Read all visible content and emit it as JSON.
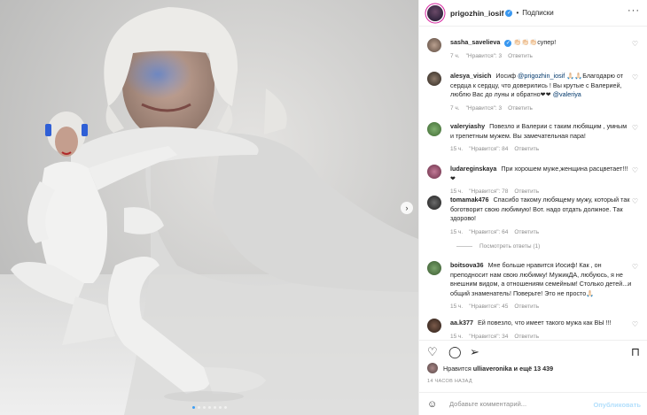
{
  "header": {
    "username": "prigozhin_iosif",
    "separator": "•",
    "follow_label": "Подписки",
    "more_icon": "more-horizontal-icon"
  },
  "comments": [
    {
      "user": "sasha_savelieva",
      "verified": true,
      "text": "👏🏻👏🏻👏🏻супер!",
      "time": "7 ч.",
      "likes": "\"Нравится\": 3",
      "reply": "Ответить"
    },
    {
      "user": "alesya_visich",
      "verified": false,
      "mention_pre": "Иосиф ",
      "mention1": "@prigozhin_iosif",
      "text_mid": " 🙏🏻🙏🏻Благодарю от сердца к сердцу, что доверились ! Вы крутые с Валерией, люблю Вас до луны и обратно❤❤ ",
      "mention2": "@valeriya",
      "time": "7 ч.",
      "likes": "\"Нравится\": 3",
      "reply": "Ответить"
    },
    {
      "user": "valeryiashy",
      "text": "Повезло и Валерии с таким любящим , умным и трепетным мужем. Вы замечательная пара!",
      "time": "15 ч.",
      "likes": "\"Нравится\": 84",
      "reply": "Ответить"
    },
    {
      "user": "ludareginskaya",
      "text": "При хорошем муже,женщина расцветает!!!❤",
      "time": "15 ч.",
      "likes": "\"Нравится\": 78",
      "reply": "Ответить"
    },
    {
      "user": "tomamak476",
      "text": "Спасибо такому любящему мужу, который так боготворит свою любимую! Вот. надо отдать должное. Так здорово!",
      "time": "15 ч.",
      "likes": "\"Нравится\": 64",
      "reply": "Ответить"
    },
    {
      "user": "boitsova36",
      "text": "Мне больше нравится Иосиф! Как , он преподносит нам свою любимку! МужикДА, любуюсь, я не внешним видом, а отношениям семейным! Столько детей...и общий знаменатель! Поверьте! Это не просто🙏🏻",
      "time": "15 ч.",
      "likes": "\"Нравится\": 45",
      "reply": "Ответить"
    },
    {
      "user": "aa.k377",
      "text": "Ей повезло, что имеет такого мужа как ВЫ !!!",
      "time": "15 ч.",
      "likes": "\"Нравится\": 34",
      "reply": "Ответить"
    }
  ],
  "view_replies": "Посмотреть ответы (1)",
  "actions": {
    "like_icon": "heart-icon",
    "comment_icon": "comment-icon",
    "share_icon": "send-icon",
    "save_icon": "bookmark-icon"
  },
  "likes": {
    "prefix": "Нравится",
    "user": "ulliaveronika",
    "and_more": "и ещё 13 439"
  },
  "timestamp": "14 часов назад",
  "add_comment": {
    "placeholder": "Добавьте комментарий...",
    "publish_label": "Опубликовать"
  },
  "carousel": {
    "dots_total": 7,
    "active_index": 0
  }
}
